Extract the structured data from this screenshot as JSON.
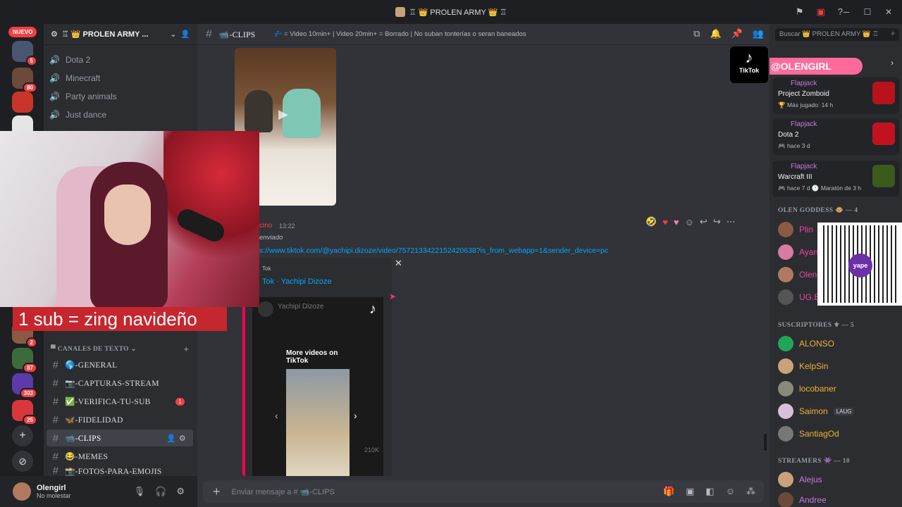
{
  "window": {
    "title": "♖ 👑 PROLEN ARMY 👑 ♖",
    "controls": [
      "─",
      "☐",
      "✕"
    ]
  },
  "rail": {
    "new_label": "NUEVO",
    "servers": [
      {
        "count": "5"
      },
      {
        "count": "80"
      },
      {
        "count": ""
      },
      {
        "count": ""
      },
      {
        "count": "2"
      },
      {
        "count": "87"
      },
      {
        "count": "303"
      },
      {
        "count": "25"
      }
    ]
  },
  "guild": {
    "name": "♖ 👑 PROLEN ARMY ...",
    "voice_channels": [
      "Dota 2",
      "Minecraft",
      "Party animals",
      "Just dance"
    ],
    "category": "CANALES DE TEXTO",
    "channels": [
      {
        "name": "🌎-GENERAL",
        "badge": ""
      },
      {
        "name": "📷-CAPTURAS-STREAM",
        "badge": ""
      },
      {
        "name": "✅-VERIFICA-TU-SUB",
        "badge": "1"
      },
      {
        "name": "🦋-FIDELIDAD",
        "badge": ""
      },
      {
        "name": "📹-CLIPS",
        "badge": ""
      },
      {
        "name": "😂-MEMES",
        "badge": ""
      },
      {
        "name": "📸-FOTOS-PARA-EMOJIS",
        "badge": ""
      }
    ]
  },
  "user": {
    "name": "Olengirl",
    "status": "No molestar"
  },
  "channel_header": {
    "name": "📹-CLIPS",
    "topic": "💤 = Video 10min+ | Video 20min+ = Borrado | No suban tonterías o seran baneados"
  },
  "message": {
    "author": "cino",
    "time": "13:22",
    "line": "enviado",
    "link": "s://www.tiktok.com/@yachipi.dizoze/video/7572133422152420638?is_from_webapp=1&sender_device=pc",
    "embed_provider": "Tok",
    "embed_title": "Tok · Yachipi Dizoze",
    "embed_account": "Yachipi Dizoze",
    "more_videos": "More videos on TikTok",
    "likes": "210K"
  },
  "composer": {
    "placeholder": "Enviar mensaje a # 📹-CLIPS"
  },
  "search": {
    "placeholder": "Buscar 👑 PROLEN ARMY 👑 ♖"
  },
  "activities": [
    {
      "app": "Flapjack",
      "game": "Project Zomboid",
      "sub": "🏆 Más jugado: 14 h",
      "color": "#b8121c"
    },
    {
      "app": "Flapjack",
      "game": "Dota 2",
      "sub": "🎮 hace 3 d",
      "color": "#c2121f"
    },
    {
      "app": "Flapjack",
      "game": "Warcraft III",
      "sub": "🎮 hace 7 d  🕐 Maratón de 3 h",
      "color": "#3c5a1c"
    }
  ],
  "member_groups": {
    "goddess": "OLEN GODDESS 🐵 — 4",
    "goddess_members": [
      "Plin",
      "Ayan",
      "Olen",
      "UG.E"
    ],
    "subs": "SUSCRIPTORES ⚜ — 5",
    "sub_members": [
      {
        "name": "ALONSO",
        "color": "#f0b232",
        "tag": ""
      },
      {
        "name": "KelpSin",
        "color": "#f0b232",
        "tag": ""
      },
      {
        "name": "locobaner",
        "color": "#f0b232",
        "tag": ""
      },
      {
        "name": "Saimon",
        "color": "#f0b232",
        "tag": "LAUG"
      },
      {
        "name": "SantiagOd",
        "color": "#f0b232",
        "tag": ""
      }
    ],
    "streamers": "STREAMERS 👾 — 10",
    "streamer_members": [
      {
        "name": "Alejus",
        "color": "#c27ae0"
      },
      {
        "name": "Andree",
        "color": "#c27ae0"
      }
    ]
  },
  "overlay": {
    "tiktok_label": "TikTok",
    "handle": "@OLENGIRL",
    "sub_text": "1 sub = zing navideño",
    "qr_label": "yape"
  }
}
